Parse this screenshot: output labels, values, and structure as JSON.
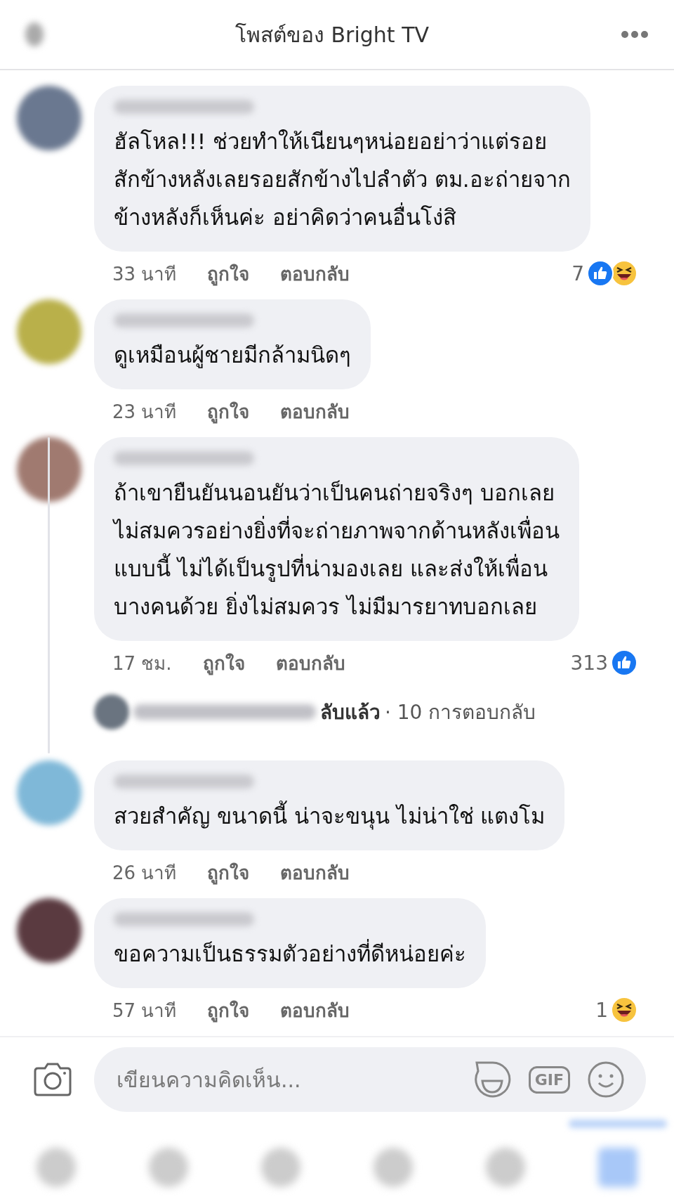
{
  "header": {
    "title": "โพสต์ของ Bright TV"
  },
  "comments": [
    {
      "lines": [
        "ฮัลโหล!!! ช่วยทำให้เนียนๆหน่อยอย่าว่าแต่รอย",
        "สักข้างหลังเลยรอยสักข้างไปลำตัว ตม.อะถ่ายจาก",
        "ข้างหลังก็เห็นค่ะ อย่าคิดว่าคนอื่นโง่สิ"
      ],
      "time": "33 นาที",
      "like": "ถูกใจ",
      "reply": "ตอบกลับ",
      "count": "7",
      "reactions": [
        {
          "kind": "like"
        },
        {
          "kind": "haha"
        }
      ]
    },
    {
      "lines": [
        "ดูเหมือนผู้ชายมีกล้ามนิดๆ"
      ],
      "time": "23 นาที",
      "like": "ถูกใจ",
      "reply": "ตอบกลับ"
    },
    {
      "lines": [
        "ถ้าเขายืนยันนอนยันว่าเป็นคนถ่ายจริงๆ บอกเลย",
        "ไม่สมควรอย่างยิ่งที่จะถ่ายภาพจากด้านหลังเพื่อน",
        "แบบนี้ ไม่ได้เป็นรูปที่น่ามองเลย และส่งให้เพื่อน",
        "บางคนด้วย ยิ่งไม่สมควร ไม่มีมารยาทบอกเลย"
      ],
      "time": "17 ชม.",
      "like": "ถูกใจ",
      "reply": "ตอบกลับ",
      "count": "313",
      "reactions": [
        {
          "kind": "like"
        }
      ],
      "replies": {
        "partial": "ลับแล้ว",
        "count": "· 10 การตอบกลับ"
      }
    },
    {
      "lines": [
        "สวยสำคัญ ขนาดนี้ น่าจะขนุน ไม่น่าใช่ แตงโม"
      ],
      "time": "26 นาที",
      "like": "ถูกใจ",
      "reply": "ตอบกลับ"
    },
    {
      "lines": [
        "ขอความเป็นธรรมตัวอย่างที่ดีหน่อยค่ะ"
      ],
      "time": "57 นาที",
      "like": "ถูกใจ",
      "reply": "ตอบกลับ",
      "count": "1",
      "reactions": [
        {
          "kind": "haha"
        }
      ]
    }
  ],
  "composer": {
    "placeholder": "เขียนความคิดเห็น...",
    "gif": "GIF"
  },
  "nav": [
    {
      "selected": false
    },
    {
      "selected": false
    },
    {
      "selected": false
    },
    {
      "selected": false
    },
    {
      "selected": false
    },
    {
      "selected": true
    }
  ]
}
